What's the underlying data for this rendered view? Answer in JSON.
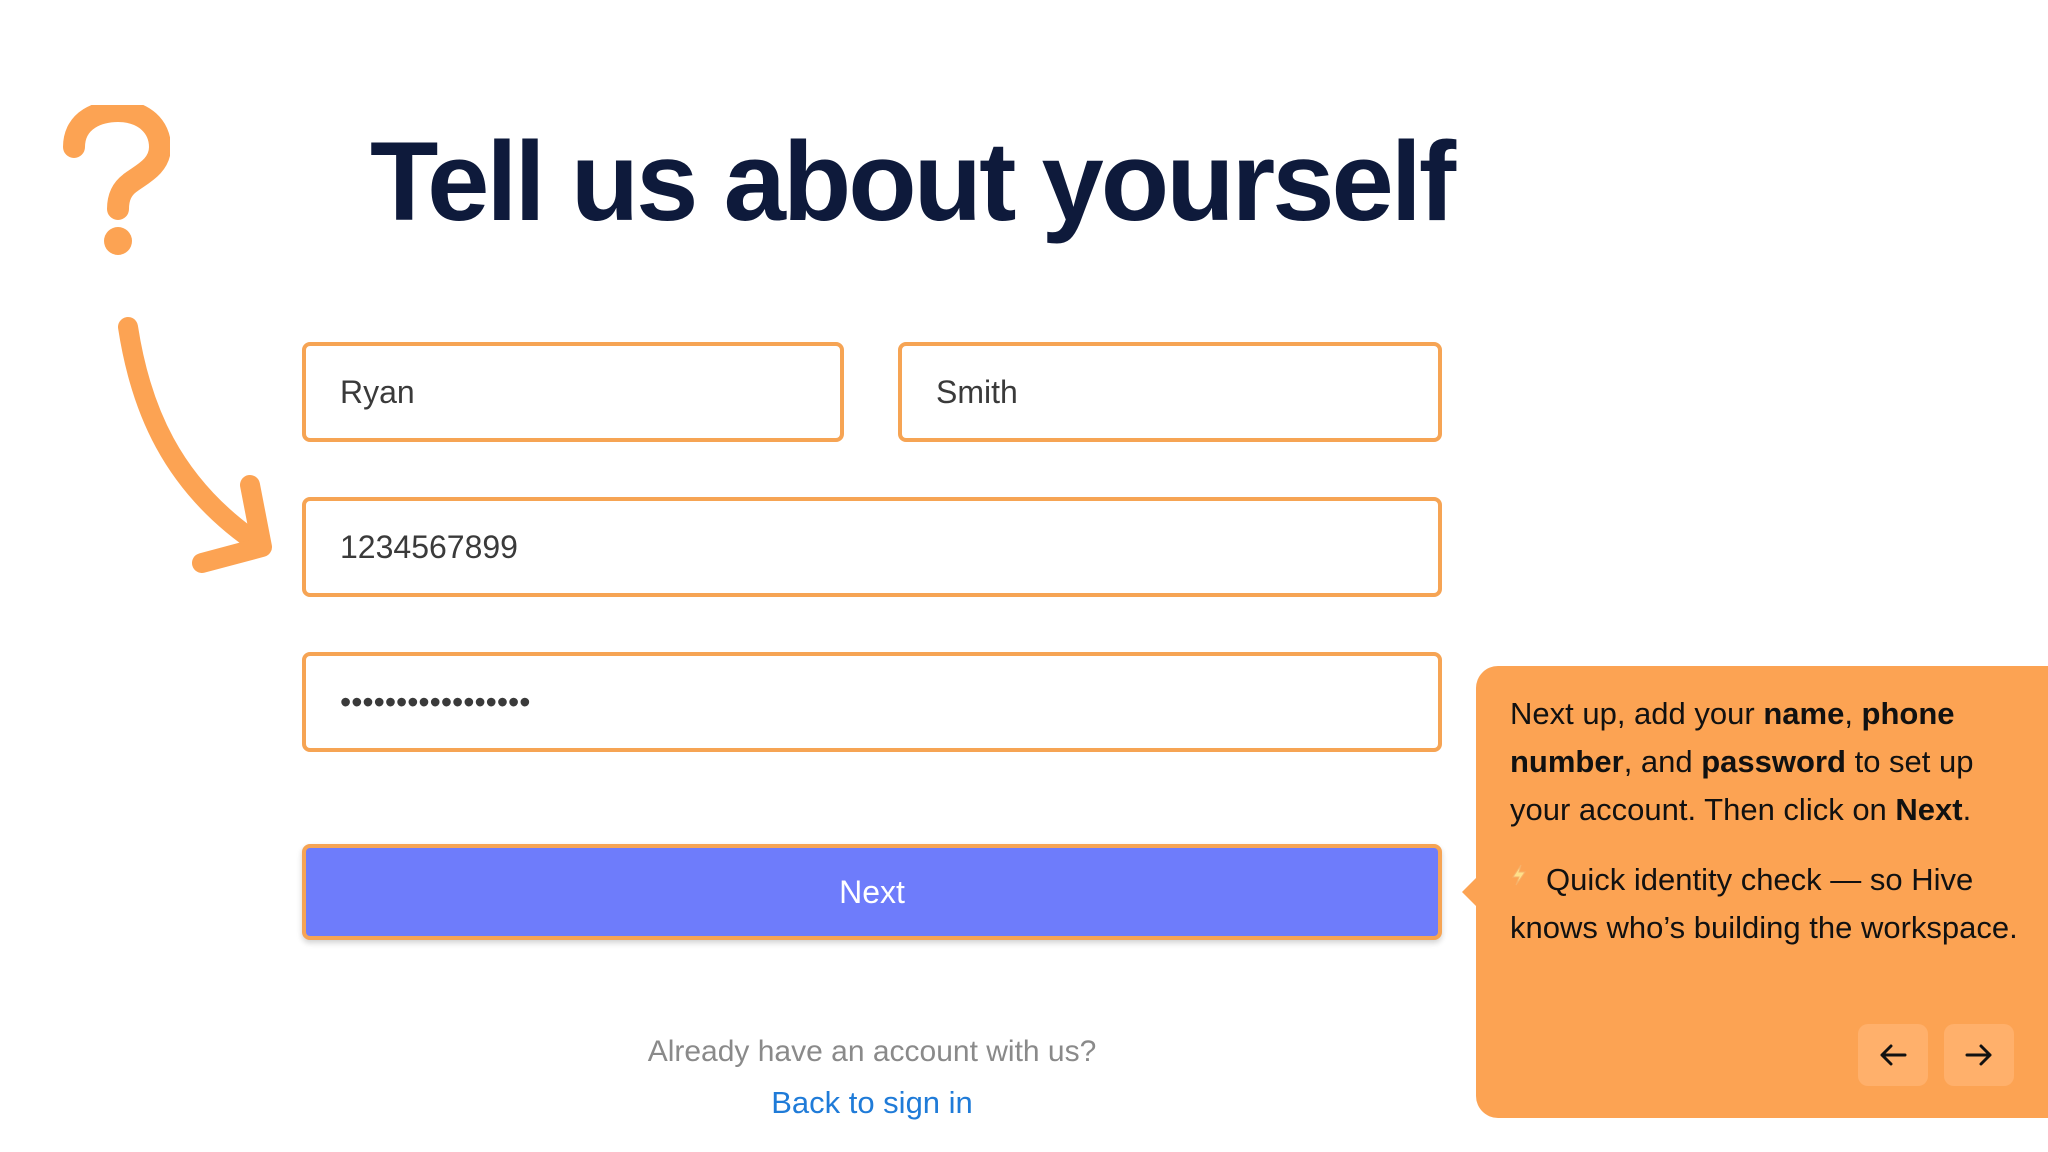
{
  "page": {
    "title": "Tell us about yourself"
  },
  "form": {
    "first_name": "Ryan",
    "last_name": "Smith",
    "phone": "1234567899",
    "password_mask": "•••••••••••••••••",
    "next_label": "Next"
  },
  "footer": {
    "already_text": "Already have an account with us?",
    "signin_link": "Back to sign in"
  },
  "tooltip": {
    "intro": "Next up, add your ",
    "name": "name",
    "comma1": ", ",
    "phone": "phone number",
    "and": ", and ",
    "password": "password",
    "to_setup": " to set up your account. Then click on ",
    "next": "Next",
    "period": ".",
    "note": "Quick identity check — so Hive knows who’s building the workspace.",
    "prev_icon": "arrow-left-icon",
    "next_icon": "arrow-right-icon"
  },
  "colors": {
    "accent_orange": "#fca353",
    "field_border": "#f6a454",
    "button_blue": "#6e7cfb",
    "title_navy": "#0e1a3b",
    "link_blue": "#1f7bd8"
  }
}
